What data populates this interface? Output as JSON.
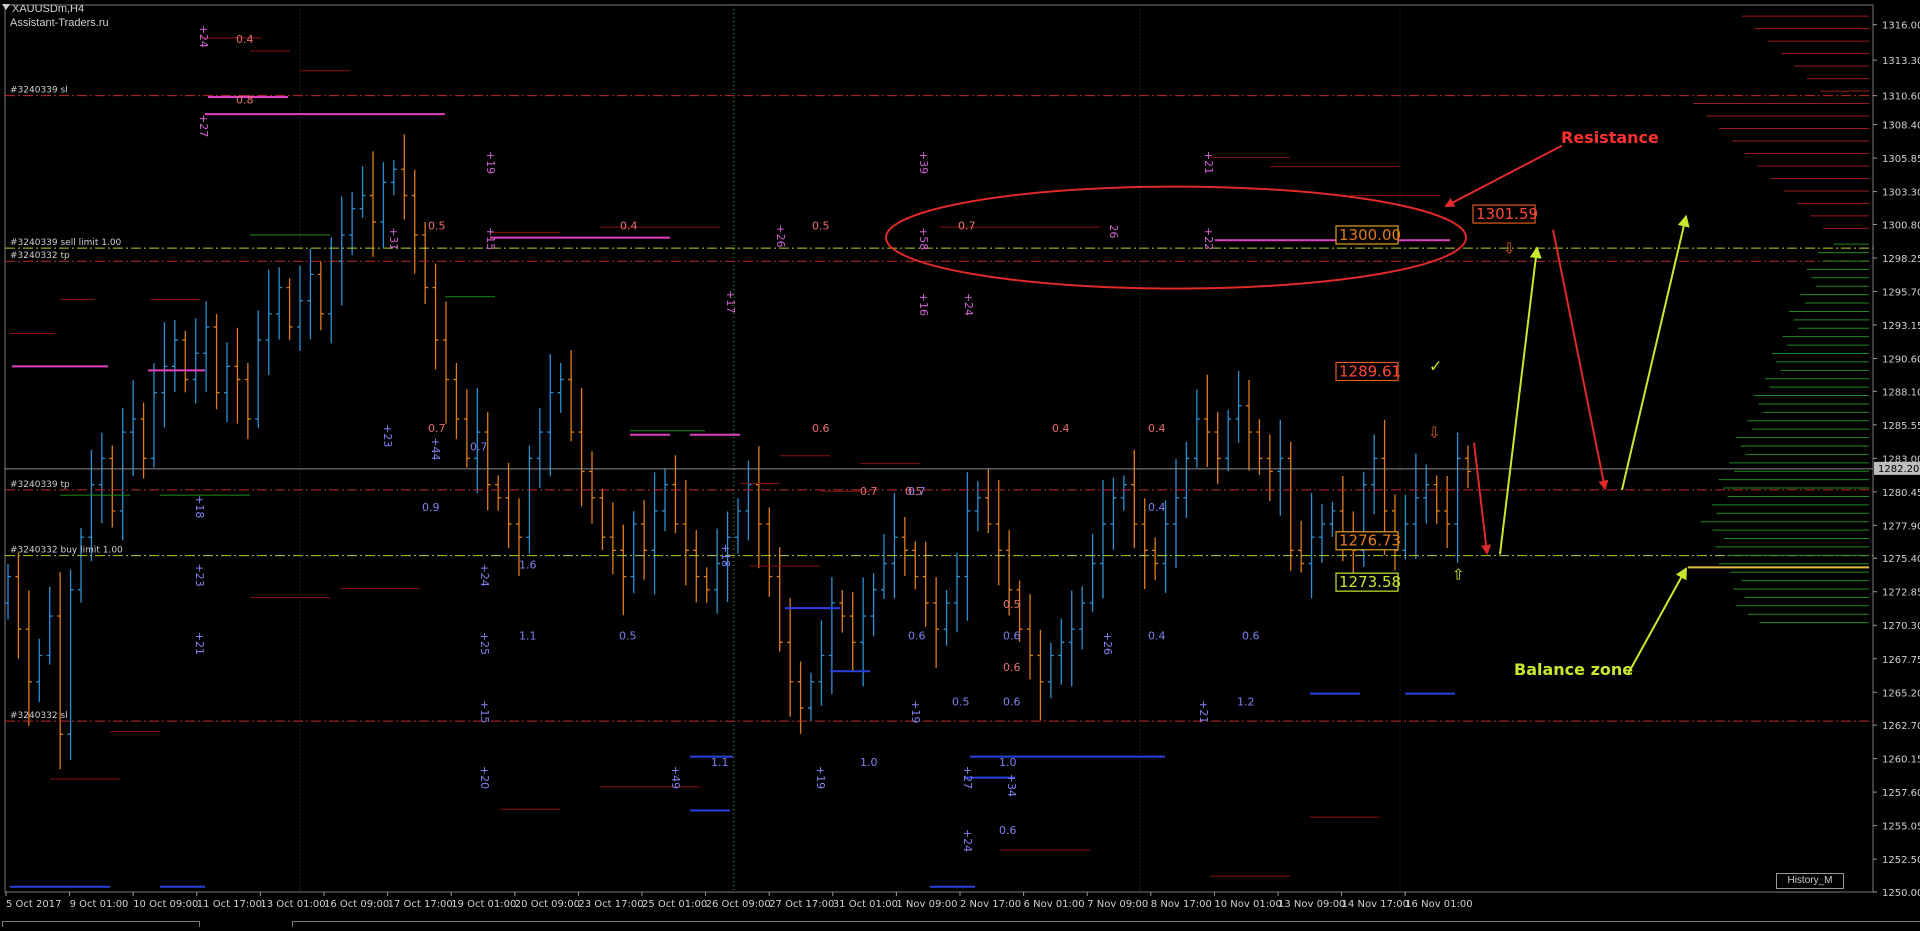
{
  "window": {
    "title": "XAUUSDm,H4",
    "subtitle": "Assistant-Traders.ru",
    "history_button": "History_M"
  },
  "colors": {
    "background": "#000000",
    "bull_candle": "#2b8fd8",
    "bear_candle": "#e07b1a",
    "resistance": "#e02a2a",
    "support_arrow": "#c8e830",
    "sl_line": "#c02a2a",
    "tp_line": "#c02a2a",
    "limit_line": "#b0d02a",
    "magenta": "#e040c0",
    "blue_level": "#2a40e0",
    "axis_text": "#d0d0d0",
    "grid": "#1e5e1e"
  },
  "chart_data": {
    "type": "candlestick",
    "symbol": "XAUUSDm",
    "timeframe": "H4",
    "ylim": [
      1250.0,
      1317.5
    ],
    "y_ticks": [
      1316.0,
      1313.3,
      1310.6,
      1308.4,
      1305.85,
      1303.3,
      1300.8,
      1298.25,
      1295.7,
      1293.15,
      1290.6,
      1288.1,
      1285.55,
      1283.0,
      1280.45,
      1277.9,
      1275.4,
      1272.85,
      1270.3,
      1267.75,
      1265.2,
      1262.7,
      1260.15,
      1257.6,
      1255.05,
      1252.5,
      1250.0
    ],
    "y_tick_labels": [
      "1316.00",
      "1313.30",
      "1310.60",
      "1308.40",
      "1305.85",
      "1303.30",
      "1300.80",
      "1298.25",
      "1295.70",
      "1293.15",
      "1290.60",
      "1288.10",
      "1285.55",
      "1283.00",
      "1280.45",
      "1277.90",
      "1275.40",
      "1272.85",
      "1270.30",
      "1267.75",
      "1265.20",
      "1262.70",
      "1260.15",
      "1257.60",
      "1255.05",
      "1252.50",
      "1250.00"
    ],
    "x_labels": [
      "5 Oct 2017",
      "9 Oct 01:00",
      "10 Oct 09:00",
      "11 Oct 17:00",
      "13 Oct 01:00",
      "16 Oct 09:00",
      "17 Oct 17:00",
      "19 Oct 01:00",
      "20 Oct 09:00",
      "23 Oct 17:00",
      "25 Oct 01:00",
      "26 Oct 09:00",
      "27 Oct 17:00",
      "31 Oct 01:00",
      "1 Nov 09:00",
      "2 Nov 17:00",
      "6 Nov 01:00",
      "7 Nov 09:00",
      "8 Nov 17:00",
      "10 Nov 01:00",
      "13 Nov 09:00",
      "14 Nov 17:00",
      "16 Nov 01:00"
    ],
    "current_price": 1282.2,
    "current_price_label": "1282.20",
    "closes": [
      1274,
      1270,
      1266,
      1268,
      1271,
      1262,
      1273,
      1277,
      1281,
      1283,
      1279,
      1285,
      1286,
      1283,
      1288,
      1290,
      1292,
      1289,
      1291,
      1293,
      1288,
      1290,
      1289,
      1286,
      1292,
      1294,
      1296,
      1293,
      1295,
      1297,
      1294,
      1298,
      1300,
      1302,
      1303,
      1301,
      1304,
      1305,
      1303,
      1300,
      1296,
      1292,
      1289,
      1286,
      1283,
      1285,
      1281,
      1280,
      1278,
      1277,
      1283,
      1285,
      1288,
      1289,
      1285,
      1282,
      1280,
      1277,
      1276,
      1274,
      1278,
      1276,
      1279,
      1281,
      1278,
      1276,
      1274,
      1273,
      1275,
      1277,
      1279,
      1281,
      1278,
      1274,
      1269,
      1266,
      1264,
      1266,
      1268,
      1272,
      1271,
      1269,
      1271,
      1273,
      1275,
      1277,
      1276,
      1274,
      1272,
      1270,
      1272,
      1274,
      1279,
      1280,
      1278,
      1276,
      1273,
      1270,
      1268,
      1266,
      1268,
      1269,
      1270,
      1272,
      1275,
      1278,
      1280,
      1281,
      1278,
      1276,
      1275,
      1278,
      1280,
      1283,
      1286,
      1285,
      1283,
      1286,
      1287,
      1285,
      1283,
      1282,
      1283,
      1276,
      1275,
      1277,
      1278,
      1279,
      1277,
      1276,
      1281,
      1283,
      1279,
      1276,
      1278,
      1280,
      1281,
      1279,
      1278,
      1283,
      1282
    ],
    "opens": [
      1272,
      1274,
      1270,
      1266,
      1268,
      1271,
      1262,
      1273,
      1277,
      1281,
      1283,
      1279,
      1285,
      1286,
      1283,
      1288,
      1290,
      1292,
      1289,
      1291,
      1293,
      1288,
      1290,
      1289,
      1286,
      1292,
      1294,
      1296,
      1293,
      1295,
      1297,
      1294,
      1298,
      1300,
      1302,
      1303,
      1301,
      1304,
      1305,
      1303,
      1300,
      1296,
      1292,
      1289,
      1286,
      1283,
      1285,
      1281,
      1280,
      1278,
      1277,
      1283,
      1285,
      1288,
      1289,
      1285,
      1282,
      1280,
      1277,
      1276,
      1274,
      1278,
      1276,
      1279,
      1281,
      1278,
      1276,
      1274,
      1273,
      1275,
      1277,
      1279,
      1281,
      1278,
      1274,
      1269,
      1266,
      1264,
      1266,
      1268,
      1272,
      1271,
      1269,
      1271,
      1273,
      1275,
      1277,
      1276,
      1274,
      1272,
      1270,
      1272,
      1274,
      1279,
      1280,
      1278,
      1276,
      1273,
      1270,
      1268,
      1266,
      1268,
      1269,
      1270,
      1272,
      1275,
      1278,
      1280,
      1281,
      1278,
      1276,
      1275,
      1278,
      1280,
      1283,
      1286,
      1285,
      1283,
      1286,
      1287,
      1285,
      1283,
      1282,
      1283,
      1276,
      1275,
      1277,
      1278,
      1279,
      1277,
      1276,
      1281,
      1283,
      1279,
      1276,
      1278,
      1280,
      1281,
      1279,
      1278,
      1283
    ],
    "h_lines": [
      {
        "name": "#3240339 sl",
        "price": 1310.6,
        "style": "dashdot",
        "color": "#c02a2a"
      },
      {
        "name": "#3240339 sell limit 1.00",
        "price": 1299.0,
        "style": "dashdot",
        "color": "#b0d02a"
      },
      {
        "name": "#3240332 tp",
        "price": 1298.0,
        "style": "dashdot",
        "color": "#c02a2a"
      },
      {
        "name": "#3240339 tp",
        "price": 1280.6,
        "style": "dashdot",
        "color": "#c02a2a"
      },
      {
        "name": "#3240332 buy limit 1.00",
        "price": 1275.6,
        "style": "dashdot",
        "color": "#b0d02a"
      },
      {
        "name": "#3240332 sl",
        "price": 1263.0,
        "style": "dashdot",
        "color": "#c02a2a"
      }
    ],
    "price_boxes": [
      {
        "label": "1301.59",
        "price": 1301.59,
        "color": "#e05a1a",
        "text_color": "#ff4a3a"
      },
      {
        "label": "1300.00",
        "price": 1300.0,
        "color": "#e0a020",
        "text_color": "#e07b1a"
      },
      {
        "label": "1289.61",
        "price": 1289.61,
        "color": "#e05a1a",
        "text_color": "#ff4a3a"
      },
      {
        "label": "1276.73",
        "price": 1276.73,
        "color": "#e0a020",
        "text_color": "#e07b1a"
      },
      {
        "label": "1273.58",
        "price": 1273.58,
        "color": "#c8e830",
        "text_color": "#c8e830"
      }
    ],
    "annotations": [
      {
        "text": "Resistance",
        "color": "#ff3030"
      },
      {
        "text": "Balance zone",
        "color": "#c8e830"
      }
    ],
    "marker_labels_pink": [
      "+24",
      "0.4",
      "+27",
      "0.8",
      "+19",
      "+31",
      "0.5",
      "+15",
      "0.4",
      "+26",
      "0.5",
      "+39",
      "+58",
      "0.7",
      "26",
      "+21",
      "+22",
      "+17",
      "+16",
      "+24",
      "0.7",
      "0.6",
      "0.4",
      "0.4",
      "0.7",
      "0.5",
      "0.5",
      "0.6"
    ],
    "marker_labels_blue": [
      "+23",
      "+44",
      "0.7",
      "0.9",
      "+18",
      "+23",
      "+24",
      "1.6",
      "+18",
      "0.7",
      "0.4",
      "+21",
      "+25",
      "1.1",
      "0.5",
      "0.6",
      "0.6",
      "+26",
      "0.4",
      "0.6",
      "+15",
      "+19",
      "0.5",
      "0.6",
      "+21",
      "1.2",
      "+20",
      "+49",
      "1.1",
      "+19",
      "1.0",
      "+27",
      "1.0",
      "+34",
      "+24",
      "0.6"
    ]
  }
}
